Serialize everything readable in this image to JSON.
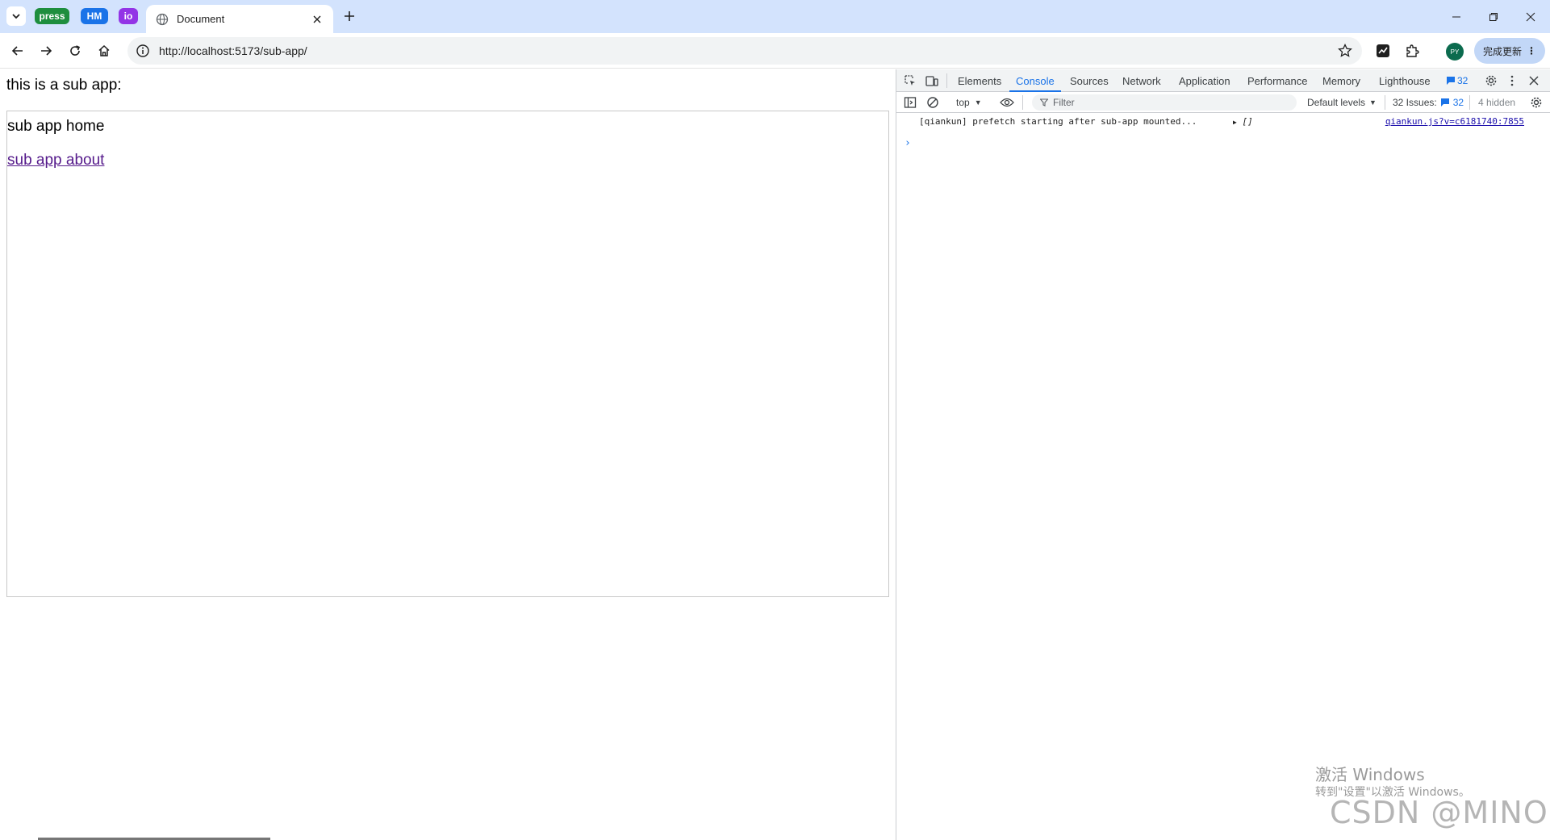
{
  "browser": {
    "pinned_tabs": [
      {
        "label": "press",
        "color": "#1e8e3e"
      },
      {
        "label": "HM",
        "color": "#1a73e8"
      },
      {
        "label": "io",
        "color": "#9334e6"
      }
    ],
    "active_tab": {
      "title": "Document",
      "icon": "globe-icon"
    },
    "url": "http://localhost:5173/sub-app/",
    "profile_initials": "PY",
    "update_label": "完成更新"
  },
  "page": {
    "intro_text": "this is a sub app:",
    "sub_home": "sub app home",
    "sub_about_link": "sub app about"
  },
  "devtools": {
    "tabs": [
      "Elements",
      "Console",
      "Sources",
      "Network",
      "Application",
      "Performance",
      "Memory",
      "Lighthouse"
    ],
    "active_tab": "Console",
    "issue_badge_count": "32",
    "context": "top",
    "filter_placeholder": "Filter",
    "levels_label": "Default levels",
    "issues_label": "32 Issues:",
    "issues_count": "32",
    "hidden_label": "4 hidden",
    "console_messages": [
      {
        "text": "[qiankun] prefetch starting after sub-app mounted...",
        "value": "[]",
        "source": "qiankun.js?v=c6181740:7855"
      }
    ]
  },
  "overlay": {
    "activate_title": "激活 Windows",
    "activate_sub": "转到\"设置\"以激活 Windows。",
    "csdn": "CSDN @MINO吖"
  }
}
